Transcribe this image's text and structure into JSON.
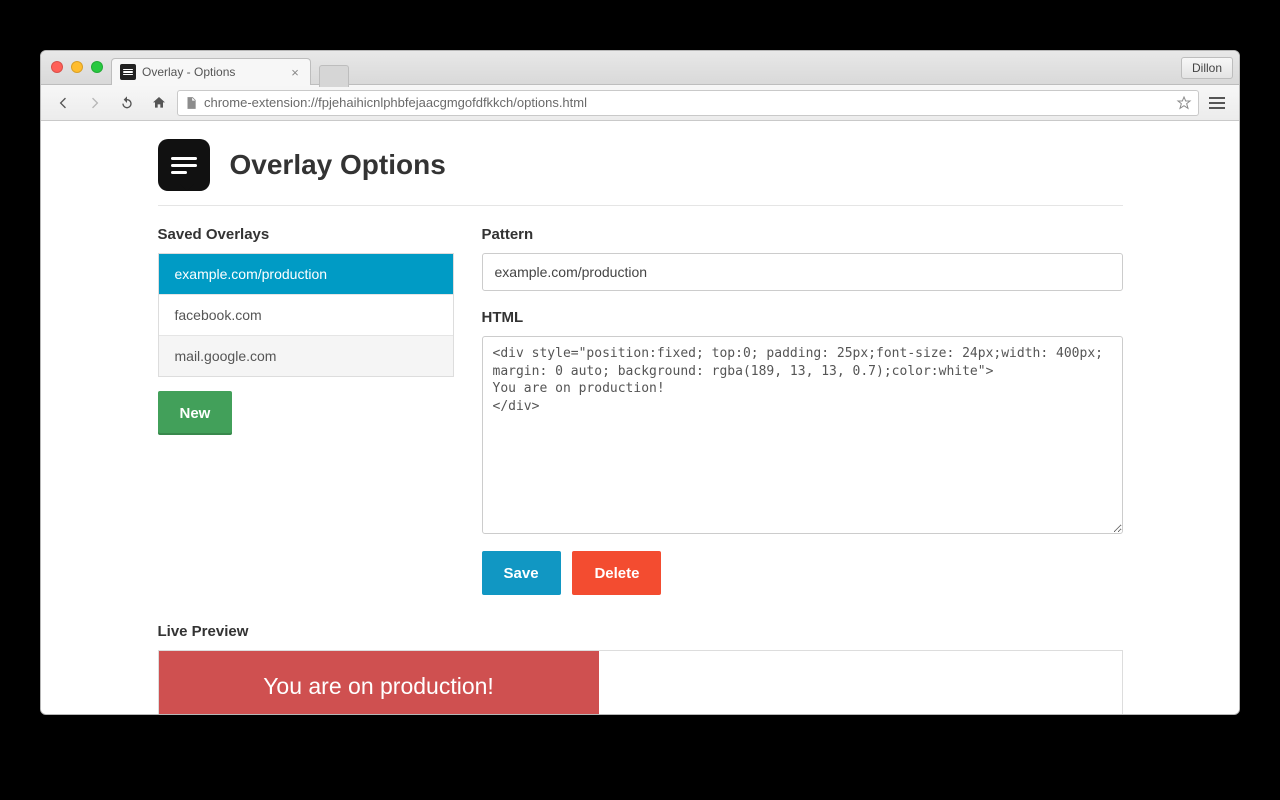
{
  "chrome": {
    "tab_title": "Overlay - Options",
    "profile_label": "Dillon",
    "url": "chrome-extension://fpjehaihicnlphbfejaacgmgofdfkkch/options.html"
  },
  "header": {
    "title": "Overlay Options"
  },
  "sidebar": {
    "heading": "Saved Overlays",
    "items": [
      "example.com/production",
      "facebook.com",
      "mail.google.com"
    ],
    "new_label": "New"
  },
  "editor": {
    "pattern_label": "Pattern",
    "pattern_value": "example.com/production",
    "html_label": "HTML",
    "html_value": "<div style=\"position:fixed; top:0; padding: 25px;font-size: 24px;width: 400px; margin: 0 auto; background: rgba(189, 13, 13, 0.7);color:white\">\nYou are on production!\n</div>",
    "save_label": "Save",
    "delete_label": "Delete"
  },
  "preview": {
    "heading": "Live Preview",
    "banner_text": "You are on production!"
  }
}
